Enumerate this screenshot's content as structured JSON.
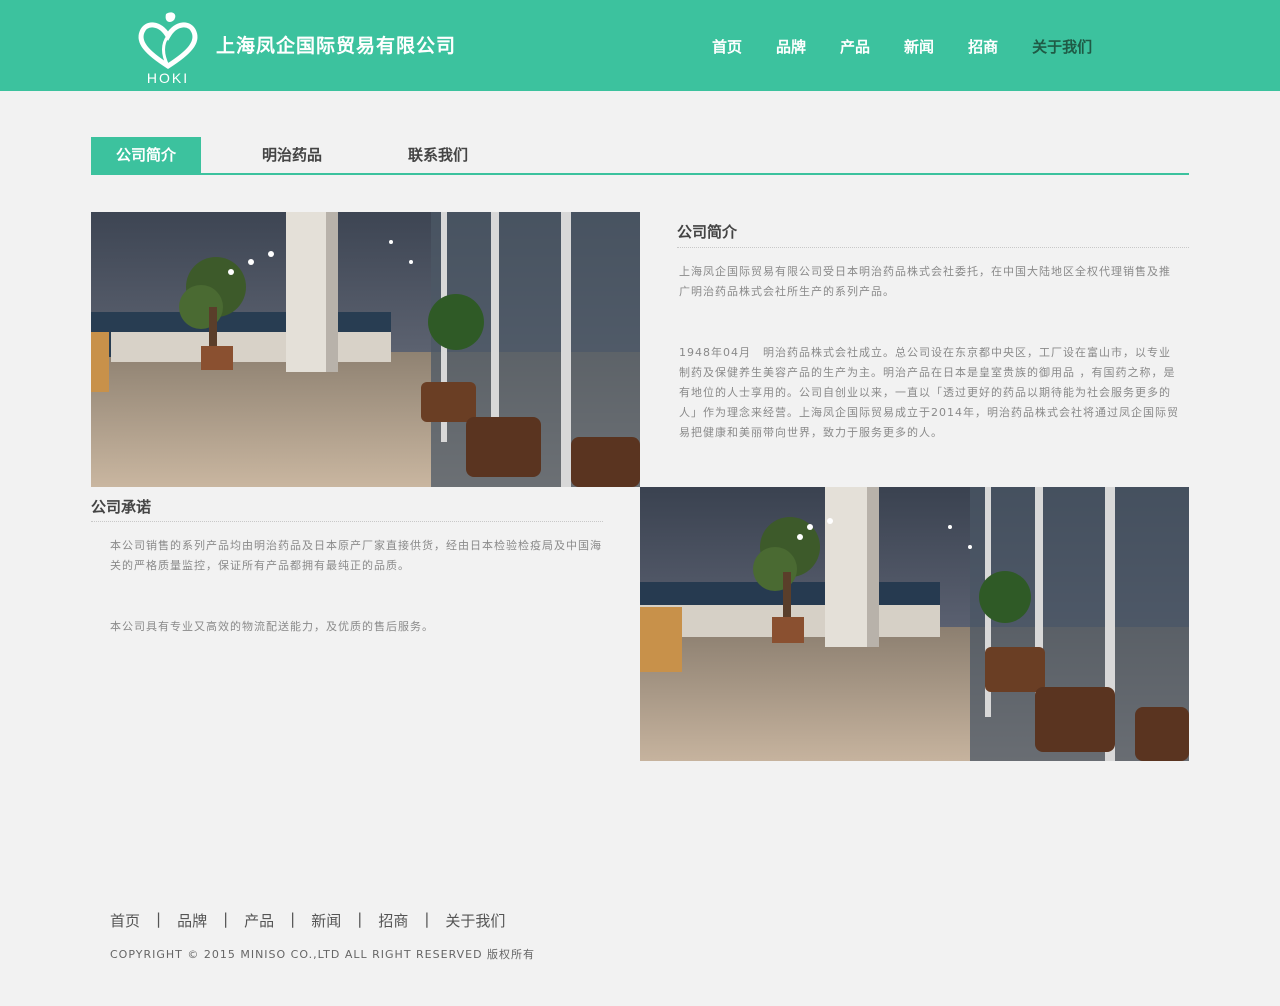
{
  "header": {
    "logo_text": "HOKI",
    "company_name": "上海凤企国际贸易有限公司",
    "brand_color": "#3cc29e",
    "nav": [
      {
        "label": "首页"
      },
      {
        "label": "品牌"
      },
      {
        "label": "产品"
      },
      {
        "label": "新闻"
      },
      {
        "label": "招商"
      },
      {
        "label": "关于我们",
        "active": true
      }
    ]
  },
  "tabs": [
    {
      "label": "公司简介",
      "active": true
    },
    {
      "label": "明治药品"
    },
    {
      "label": "联系我们"
    }
  ],
  "intro": {
    "title": "公司简介",
    "paragraphs": [
      "上海凤企国际贸易有限公司受日本明治药品株式会社委托，在中国大陆地区全权代理销售及推广明治药品株式会社所生产的系列产品。",
      "1948年04月　明治药品株式会社成立。总公司设在东京都中央区，工厂设在富山市，以专业制药及保健养生美容产品的生产为主。明治产品在日本是皇室贵族的御用品 ，有国药之称，是有地位的人士享用的。公司自创业以来，一直以「透过更好的药品以期待能为社会服务更多的人」作为理念来经营。上海凤企国际贸易成立于2014年，明治药品株式会社将通过凤企国际贸易把健康和美丽带向世界，致力于服务更多的人。"
    ]
  },
  "promise": {
    "title": "公司承诺",
    "paragraphs": [
      "本公司销售的系列产品均由明治药品及日本原产厂家直接供货，经由日本检验检疫局及中国海关的严格质量监控，保证所有产品都拥有最纯正的品质。",
      "本公司具有专业又高效的物流配送能力，及优质的售后服务。"
    ]
  },
  "footer": {
    "nav": [
      {
        "label": "首页"
      },
      {
        "label": "品牌"
      },
      {
        "label": "产品"
      },
      {
        "label": "新闻"
      },
      {
        "label": "招商"
      },
      {
        "label": "关于我们"
      }
    ],
    "separator": "|",
    "copyright": "COPYRIGHT © 2015 MINISO CO.,LTD ALL RIGHT RESERVED 版权所有"
  }
}
